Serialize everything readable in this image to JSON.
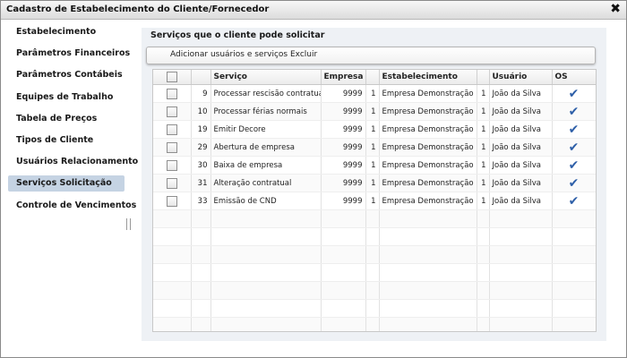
{
  "window": {
    "title": "Cadastro de Estabelecimento do Cliente/Fornecedor",
    "close_label": "✖"
  },
  "sidebar": {
    "items": [
      {
        "label": "Estabelecimento"
      },
      {
        "label": "Parâmetros Financeiros"
      },
      {
        "label": "Parâmetros Contábeis"
      },
      {
        "label": "Equipes de Trabalho"
      },
      {
        "label": "Tabela de Preços"
      },
      {
        "label": "Tipos de Cliente"
      },
      {
        "label": "Usuários Relacionamento"
      },
      {
        "label": "Serviços Solicitação",
        "active": true
      },
      {
        "label": "Controle de Vencimentos"
      }
    ]
  },
  "panel": {
    "title": "Serviços que o cliente pode solicitar",
    "toolbar": {
      "add_label": "Adicionar usuários e serviços",
      "delete_label": "Excluir"
    }
  },
  "grid": {
    "headers": {
      "servico": "Serviço",
      "empresa": "Empresa",
      "estabelecimento": "Estabelecimento",
      "usuario": "Usuário",
      "os": "OS"
    },
    "rows": [
      {
        "id": "9",
        "servico": "Processar rescisão contratual",
        "empresa": "9999",
        "est_num": "1",
        "estabelecimento": "Empresa Demonstração",
        "usr_num": "1",
        "usuario": "João da Silva",
        "os": "✔"
      },
      {
        "id": "10",
        "servico": "Processar férias normais",
        "empresa": "9999",
        "est_num": "1",
        "estabelecimento": "Empresa Demonstração",
        "usr_num": "1",
        "usuario": "João da Silva",
        "os": "✔"
      },
      {
        "id": "19",
        "servico": "Emitir Decore",
        "empresa": "9999",
        "est_num": "1",
        "estabelecimento": "Empresa Demonstração",
        "usr_num": "1",
        "usuario": "João da Silva",
        "os": "✔"
      },
      {
        "id": "29",
        "servico": "Abertura de empresa",
        "empresa": "9999",
        "est_num": "1",
        "estabelecimento": "Empresa Demonstração",
        "usr_num": "1",
        "usuario": "João da Silva",
        "os": "✔"
      },
      {
        "id": "30",
        "servico": "Baixa de empresa",
        "empresa": "9999",
        "est_num": "1",
        "estabelecimento": "Empresa Demonstração",
        "usr_num": "1",
        "usuario": "João da Silva",
        "os": "✔"
      },
      {
        "id": "31",
        "servico": "Alteração contratual",
        "empresa": "9999",
        "est_num": "1",
        "estabelecimento": "Empresa Demonstração",
        "usr_num": "1",
        "usuario": "João da Silva",
        "os": "✔"
      },
      {
        "id": "33",
        "servico": "Emissão de CND",
        "empresa": "9999",
        "est_num": "1",
        "estabelecimento": "Empresa Demonstração",
        "usr_num": "1",
        "usuario": "João da Silva",
        "os": "✔"
      }
    ]
  },
  "colors": {
    "active_item": "#c5d3e3",
    "panel_bg": "#eef1f5",
    "check": "#2e5fa8"
  }
}
